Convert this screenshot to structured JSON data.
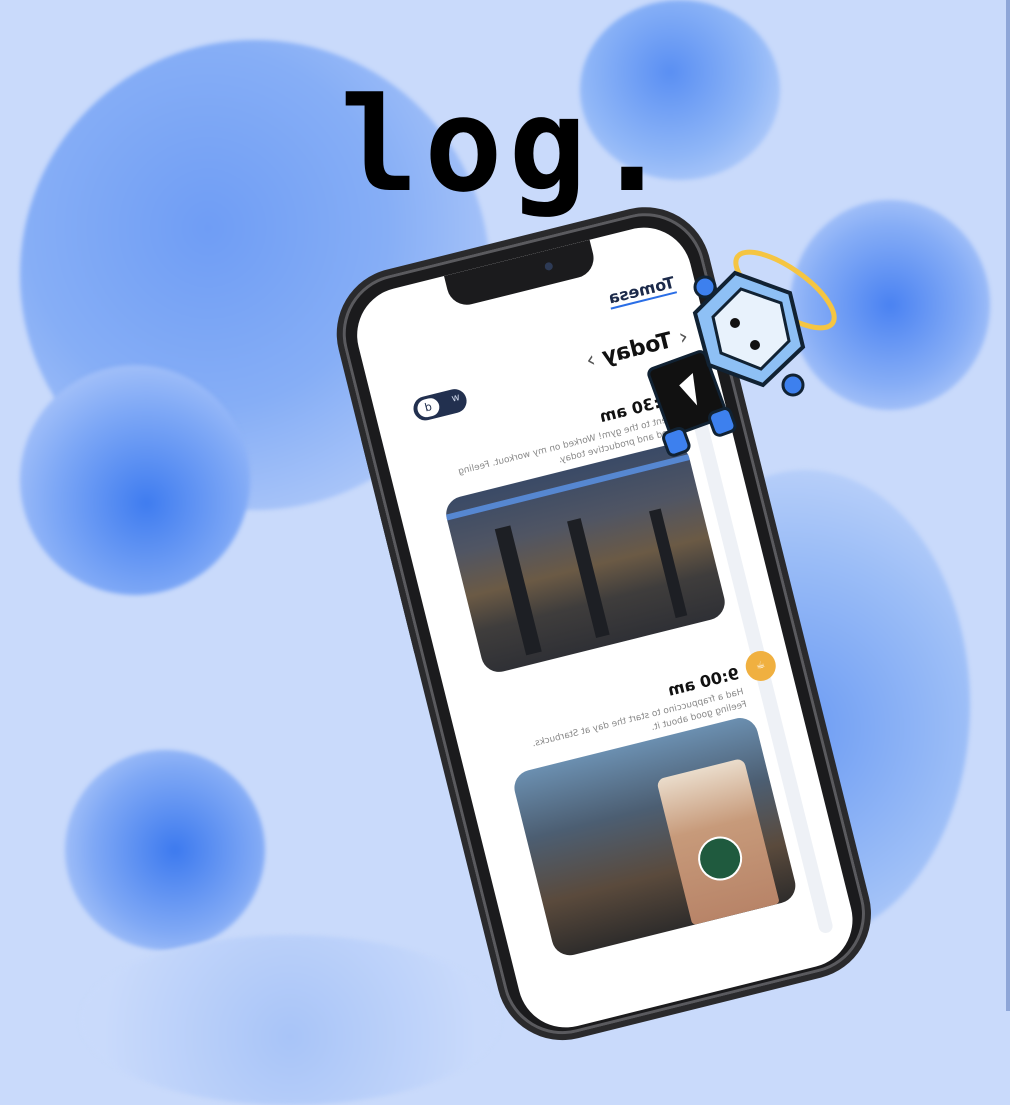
{
  "logo": {
    "text": "log."
  },
  "phone_screen": {
    "brand": "Tomesa",
    "date_label": "Today",
    "prev_chevron": "‹",
    "next_chevron": "›",
    "toggle": {
      "knob_label": "d",
      "off_label": "w"
    },
    "entries": [
      {
        "time": "7:30 am",
        "icon": "gym-icon",
        "description": "Went to the gym! Worked on my workout. Feeling good and productive today.",
        "photo": "gym interior"
      },
      {
        "time": "9:00 am",
        "icon": "coffee-icon",
        "description": "Had a frappuccino to start the day at Starbucks. Feeling good about it.",
        "photo": "starbucks drink"
      }
    ]
  },
  "colors": {
    "background": "#c9dafb",
    "accent_blue": "#3d80ee",
    "accent_yellow": "#f0b040",
    "halo": "#f5c542"
  }
}
